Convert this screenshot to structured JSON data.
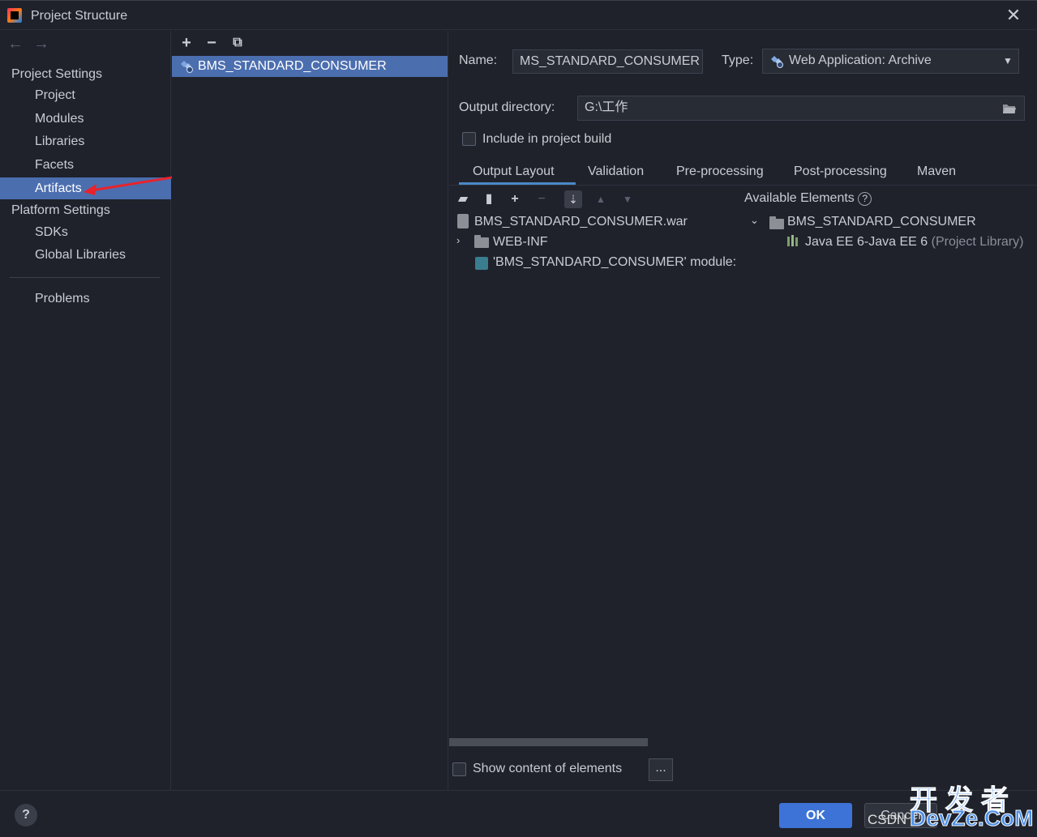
{
  "window": {
    "title": "Project Structure"
  },
  "nav": {
    "back_label": "←",
    "forward_label": "→",
    "project_settings": "Project Settings",
    "project_items": [
      "Project",
      "Modules",
      "Libraries",
      "Facets",
      "Artifacts"
    ],
    "platform_settings": "Platform Settings",
    "platform_items": [
      "SDKs",
      "Global Libraries"
    ],
    "problems": "Problems",
    "selected": "Artifacts"
  },
  "artifacts_list": {
    "toolbar": {
      "add": "+",
      "remove": "−",
      "copy": "⧉"
    },
    "items": [
      "BMS_STANDARD_CONSUMER"
    ]
  },
  "details": {
    "name_label": "Name:",
    "name_value": "MS_STANDARD_CONSUMER",
    "type_label": "Type:",
    "type_value": "Web Application: Archive",
    "output_dir_label": "Output directory:",
    "output_dir_value": "G:\\工作",
    "include_label": "Include in project build",
    "tabs": [
      "Output Layout",
      "Validation",
      "Pre-processing",
      "Post-processing",
      "Maven"
    ],
    "active_tab": "Output Layout",
    "available_label": "Available Elements",
    "layout_tree": {
      "root": "BMS_STANDARD_CONSUMER.war",
      "web_inf": "WEB-INF",
      "module": "'BMS_STANDARD_CONSUMER' module:"
    },
    "available_tree": {
      "module": "BMS_STANDARD_CONSUMER",
      "library": "Java EE 6-Java EE 6",
      "library_suffix": "(Project Library)"
    },
    "show_content_label": "Show content of elements",
    "more_label": "..."
  },
  "footer": {
    "help": "?",
    "ok": "OK",
    "cancel": "Cancel"
  },
  "watermark": {
    "cn": "开发者",
    "en": "DevZe.CoM",
    "csdn": "CSDN"
  },
  "colors": {
    "accent": "#4b6eaf",
    "ok_button": "#3d73d6",
    "background": "#1f222b",
    "arrow": "#e8232b"
  }
}
